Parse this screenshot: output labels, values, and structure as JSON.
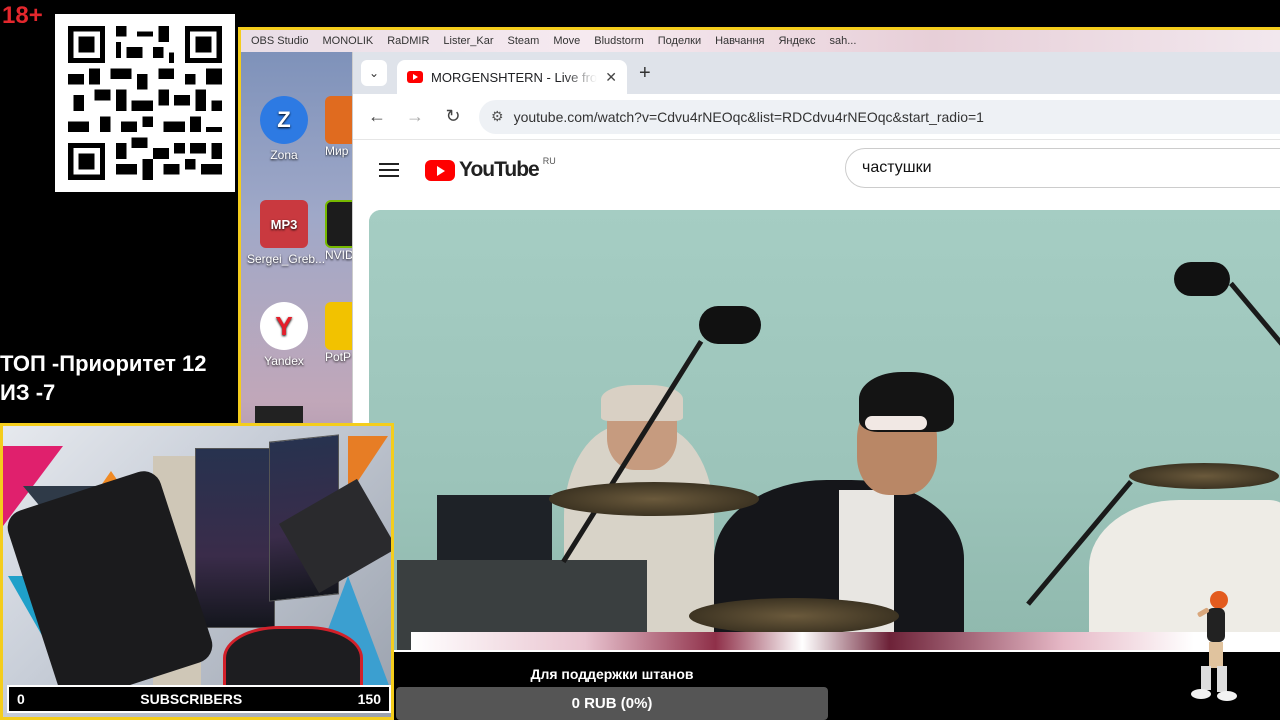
{
  "overlay": {
    "age_rating": "18+",
    "priority_line1": "ТОП -Приоритет 12",
    "priority_line2": "ИЗ -7"
  },
  "desktop": {
    "taskbar_items": [
      "OBS Studio",
      "MONOLIK",
      "RaDMIR",
      "Lister_Kar",
      "Steam",
      "Move",
      "Bludstorm",
      "Поделки",
      "Навчання",
      "Яндекс",
      "sah..."
    ],
    "icons": [
      {
        "label": "Zona",
        "glyph": "Z",
        "color": "#2d7ae3"
      },
      {
        "label": "Мир",
        "glyph": "",
        "color": "#e06b1f"
      },
      {
        "label": "Sergei_Greb...",
        "glyph": "MP3",
        "color": "#c9393f"
      },
      {
        "label": "NVID",
        "glyph": "",
        "color": "#1c1c1c"
      },
      {
        "label": "Yandex",
        "glyph": "Y",
        "color": "#ffffff"
      },
      {
        "label": "PotP",
        "glyph": "",
        "color": "#f2c200"
      }
    ]
  },
  "browser": {
    "tab_title": "MORGENSHTERN - Live from the",
    "url": "youtube.com/watch?v=Cdvu4rNEOqc&list=RDCdvu4rNEOqc&start_radio=1",
    "youtube_wordmark": "YouTube",
    "region": "RU",
    "search_query": "частушки"
  },
  "webcam": {
    "subscribers_min": "0",
    "subscribers_label": "SUBSCRIBERS",
    "subscribers_max": "150"
  },
  "donation": {
    "title": "Для поддержки штанов",
    "progress_text": "0 RUB (0%)",
    "progress": 0
  },
  "colors": {
    "frame_accent": "#f4cd1c",
    "age_badge": "#e3272d",
    "youtube_red": "#ff0000"
  }
}
